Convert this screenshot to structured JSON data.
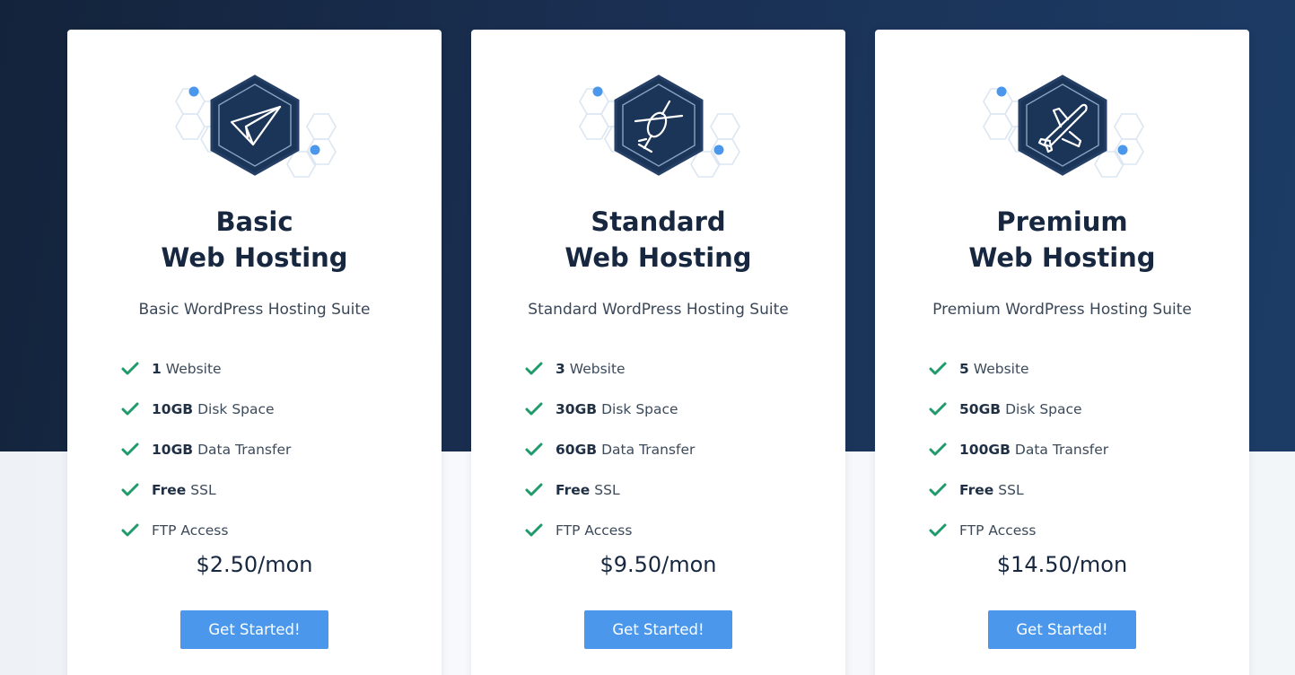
{
  "plans": [
    {
      "title_line1": "Basic",
      "title_line2": "Web Hosting",
      "subtitle": "Basic WordPress Hosting Suite",
      "icon": "paper-plane-icon",
      "features": [
        {
          "bold": "1",
          "text": "Website"
        },
        {
          "bold": "10GB",
          "text": "Disk Space"
        },
        {
          "bold": "10GB",
          "text": "Data Transfer"
        },
        {
          "bold": "Free",
          "text": "SSL"
        },
        {
          "bold": "",
          "text": "FTP Access"
        }
      ],
      "price": "$2.50/mon",
      "cta": "Get Started!"
    },
    {
      "title_line1": "Standard",
      "title_line2": "Web Hosting",
      "subtitle": "Standard WordPress Hosting Suite",
      "icon": "helicopter-icon",
      "features": [
        {
          "bold": "3",
          "text": "Website"
        },
        {
          "bold": "30GB",
          "text": "Disk Space"
        },
        {
          "bold": "60GB",
          "text": "Data Transfer"
        },
        {
          "bold": "Free",
          "text": "SSL"
        },
        {
          "bold": "",
          "text": "FTP Access"
        }
      ],
      "price": "$9.50/mon",
      "cta": "Get Started!"
    },
    {
      "title_line1": "Premium",
      "title_line2": "Web Hosting",
      "subtitle": "Premium WordPress Hosting Suite",
      "icon": "airplane-icon",
      "features": [
        {
          "bold": "5",
          "text": "Website"
        },
        {
          "bold": "50GB",
          "text": "Disk Space"
        },
        {
          "bold": "100GB",
          "text": "Data Transfer"
        },
        {
          "bold": "Free",
          "text": "SSL"
        },
        {
          "bold": "",
          "text": "FTP Access"
        }
      ],
      "price": "$14.50/mon",
      "cta": "Get Started!"
    }
  ],
  "colors": {
    "background_dark": "#13233b",
    "hexagon_fill": "#1b3559",
    "accent_blue": "#4a97ec",
    "check_green": "#1f9a6a",
    "title_text": "#16273f"
  }
}
